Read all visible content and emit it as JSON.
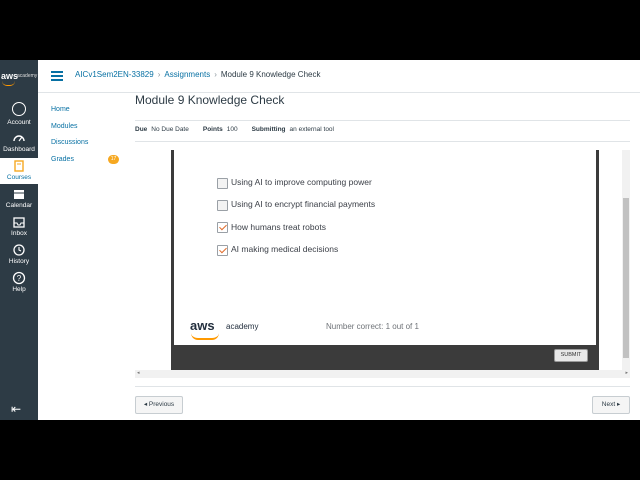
{
  "brand": {
    "logo_text": "aws",
    "logo_sub": "academy"
  },
  "global_nav": [
    {
      "label": "Account",
      "icon": "account-icon"
    },
    {
      "label": "Dashboard",
      "icon": "dashboard-icon"
    },
    {
      "label": "Courses",
      "icon": "courses-icon",
      "active": true
    },
    {
      "label": "Calendar",
      "icon": "calendar-icon"
    },
    {
      "label": "Inbox",
      "icon": "inbox-icon"
    },
    {
      "label": "History",
      "icon": "history-icon"
    },
    {
      "label": "Help",
      "icon": "help-icon"
    }
  ],
  "breadcrumbs": [
    "AICv1Sem2EN-33829",
    "Assignments",
    "Module 9 Knowledge Check"
  ],
  "course_nav": [
    {
      "label": "Home"
    },
    {
      "label": "Modules"
    },
    {
      "label": "Discussions"
    },
    {
      "label": "Grades",
      "badge": "17"
    }
  ],
  "page": {
    "title": "Module 9 Knowledge Check",
    "due_label": "Due",
    "due_value": "No Due Date",
    "points_label": "Points",
    "points_value": "100",
    "submitting_label": "Submitting",
    "submitting_value": "an external tool"
  },
  "quiz": {
    "options": [
      {
        "label": "Using AI to improve computing power",
        "checked": false
      },
      {
        "label": "Using AI to encrypt financial payments",
        "checked": false
      },
      {
        "label": "How humans treat robots",
        "checked": true
      },
      {
        "label": "AI making medical decisions",
        "checked": true
      }
    ],
    "footer_logo": "aws",
    "footer_logo_sub": "academy",
    "result": "Number correct: 1 out of 1",
    "submit_label": "SUBMIT"
  },
  "pager": {
    "previous": "◂ Previous",
    "next": "Next ▸"
  },
  "colors": {
    "link": "#0770a3",
    "nav_bg": "#2d3b45",
    "accent": "#ff9900",
    "badge": "#f6a821"
  }
}
